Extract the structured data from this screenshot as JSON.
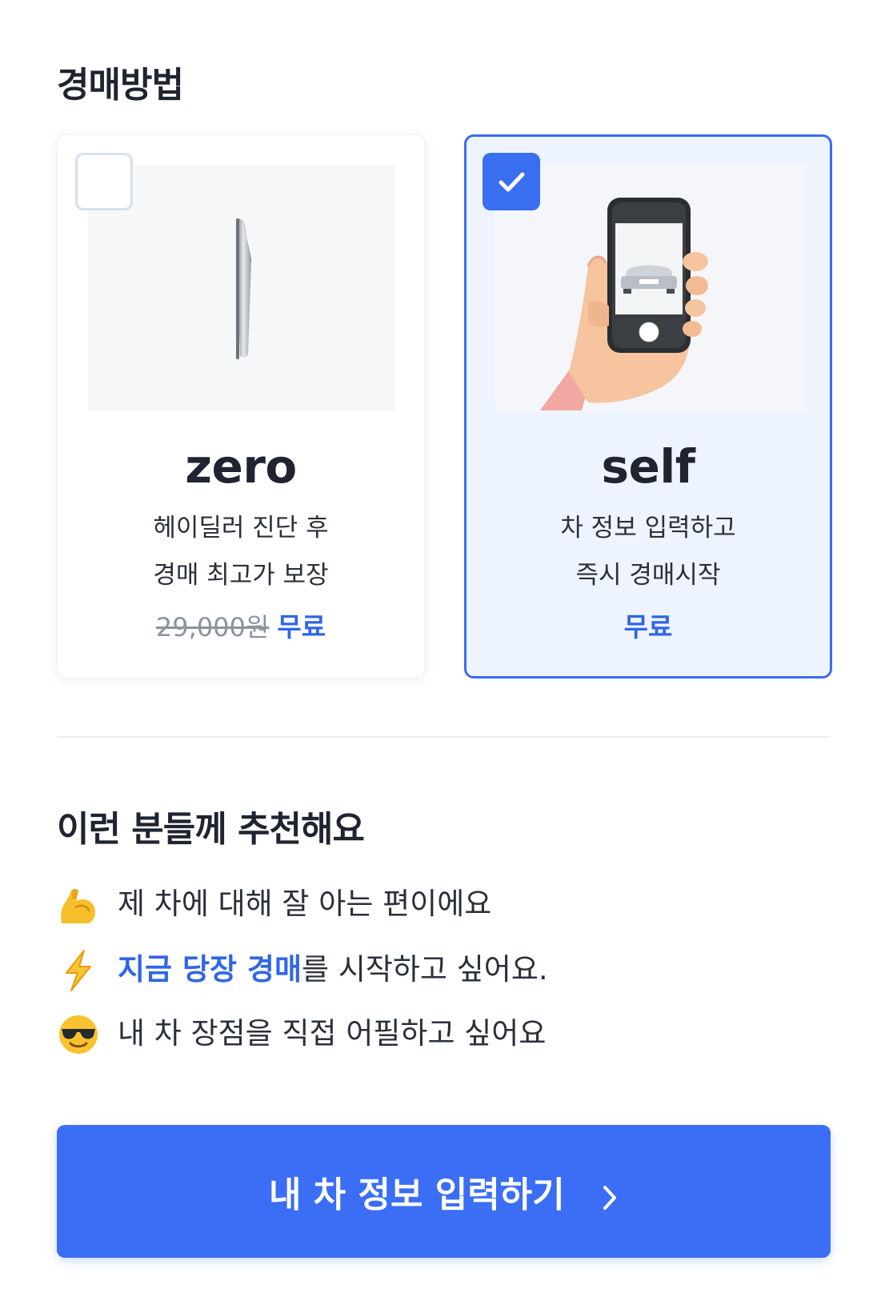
{
  "method_section": {
    "title": "경매방법",
    "cards": [
      {
        "id": "zero",
        "name": "zero",
        "selected": false,
        "desc_line1": "헤이딜러 진단 후",
        "desc_line2": "경매 최고가 보장",
        "price_original": "29,000원",
        "price_free": "무료",
        "image_icon": "phone-side-view-icon"
      },
      {
        "id": "self",
        "name": "self",
        "selected": true,
        "desc_line1": "차 정보 입력하고",
        "desc_line2": "즉시 경매시작",
        "price_free": "무료",
        "image_icon": "hand-holding-phone-icon"
      }
    ]
  },
  "recommend_section": {
    "title": "이런 분들께 추천해요",
    "items": [
      {
        "icon": "flexed-biceps-icon",
        "text": "제 차에 대해 잘 아는 편이에요"
      },
      {
        "icon": "lightning-icon",
        "highlight": "지금 당장 경매",
        "text": "를 시작하고 싶어요."
      },
      {
        "icon": "sunglasses-face-icon",
        "text": "내 차 장점을 직접 어필하고 싶어요"
      }
    ]
  },
  "cta": {
    "label": "내 차 정보 입력하기",
    "icon": "chevron-right-icon"
  },
  "colors": {
    "accent": "#3b6ef5",
    "accent_text": "#2f66e8",
    "selected_bg": "#eef4ff",
    "text": "#1f2430"
  }
}
